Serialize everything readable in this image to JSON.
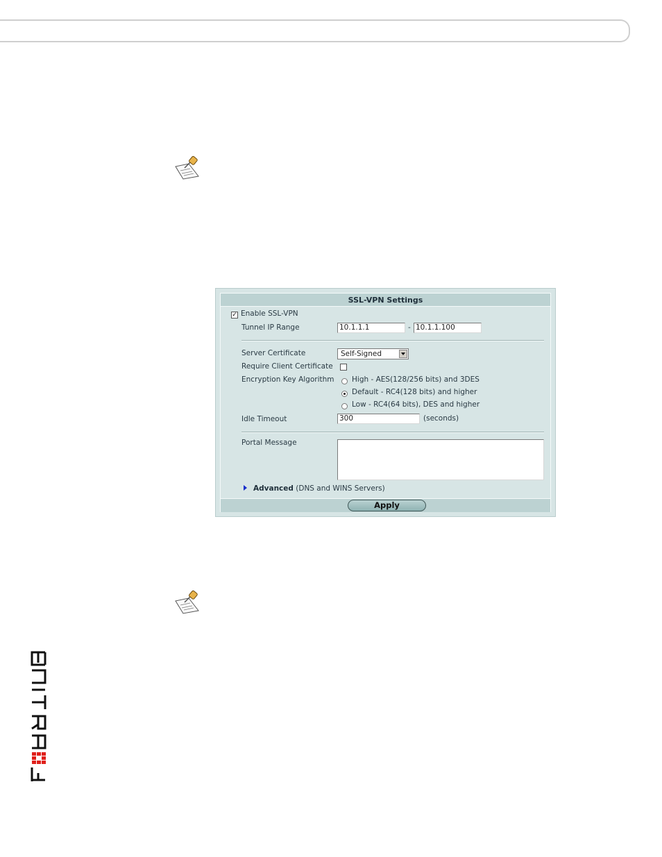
{
  "panel": {
    "title": "SSL-VPN Settings",
    "enable_ssl_vpn": {
      "label": "Enable SSL-VPN",
      "checked": true,
      "mark": "✓"
    },
    "tunnel_ip_range": {
      "label": "Tunnel IP Range",
      "start": "10.1.1.1",
      "separator": "-",
      "end": "10.1.1.100"
    },
    "server_certificate": {
      "label": "Server Certificate",
      "selected": "Self-Signed"
    },
    "require_client_certificate": {
      "label": "Require Client Certificate",
      "checked": false
    },
    "encryption_key_algorithm": {
      "label": "Encryption Key Algorithm",
      "options": [
        {
          "label": "High - AES(128/256 bits) and 3DES",
          "selected": false
        },
        {
          "label": "Default - RC4(128 bits) and higher",
          "selected": true
        },
        {
          "label": "Low - RC4(64 bits), DES and higher",
          "selected": false
        }
      ]
    },
    "idle_timeout": {
      "label": "Idle Timeout",
      "value": "300",
      "unit": "(seconds)"
    },
    "portal_message": {
      "label": "Portal Message",
      "value": ""
    },
    "advanced": {
      "label": "Advanced",
      "detail": "(DNS and WINS Servers)"
    },
    "apply_label": "Apply"
  },
  "brand": {
    "name": "FORTINET",
    "accent": "#e0201b"
  },
  "icons": [
    "note-icon",
    "note-icon"
  ]
}
